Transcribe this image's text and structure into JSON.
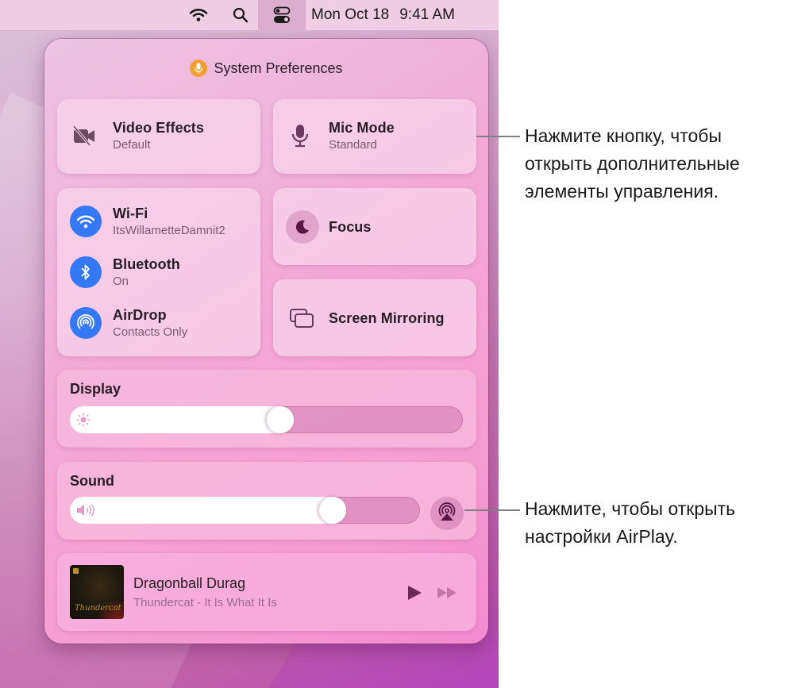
{
  "menubar": {
    "icons": [
      "wifi-icon",
      "search-icon",
      "control-center-icon"
    ],
    "date": "Mon Oct 18",
    "time": "9:41 AM"
  },
  "panel": {
    "header": {
      "icon": "microphone-icon",
      "icon_color": "#f2a035",
      "title": "System Preferences"
    },
    "video_effects": {
      "icon": "video-slash-icon",
      "title": "Video Effects",
      "subtitle": "Default"
    },
    "mic_mode": {
      "icon": "microphone-icon",
      "title": "Mic Mode",
      "subtitle": "Standard"
    },
    "network": [
      {
        "icon": "wifi-icon",
        "title": "Wi-Fi",
        "subtitle": "ItsWillametteDamnit2"
      },
      {
        "icon": "bluetooth-icon",
        "title": "Bluetooth",
        "subtitle": "On"
      },
      {
        "icon": "airdrop-icon",
        "title": "AirDrop",
        "subtitle": "Contacts Only"
      }
    ],
    "focus": {
      "icon": "moon-icon",
      "title": "Focus"
    },
    "screen_mirroring": {
      "icon": "screen-mirroring-icon",
      "title": "Screen Mirroring"
    },
    "display": {
      "label": "Display",
      "icon": "sun-icon",
      "level_percent": 57
    },
    "sound": {
      "label": "Sound",
      "icon": "speaker-icon",
      "level_percent": 79,
      "airplay_icon": "airplay-icon"
    },
    "now_playing": {
      "title": "Dragonball Durag",
      "artist_album": "Thundercat - It Is What It Is",
      "controls": [
        "play-icon",
        "fast-forward-icon"
      ]
    }
  },
  "callouts": {
    "controls": [
      "Нажмите кнопку, чтобы",
      "открыть дополнительные",
      "элементы управления."
    ],
    "airplay": [
      "Нажмите, чтобы открыть",
      "настройки AirPlay."
    ]
  },
  "colors": {
    "accent_blue": "#3478f6",
    "icon_plum": "#6b2a5a"
  }
}
